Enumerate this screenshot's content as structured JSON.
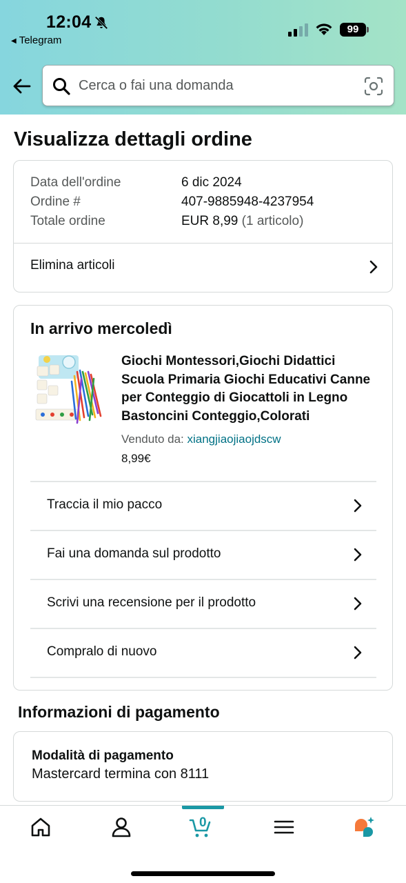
{
  "status_bar": {
    "time": "12:04",
    "back_app": "Telegram",
    "battery": "99"
  },
  "search": {
    "placeholder": "Cerca o fai una domanda"
  },
  "page": {
    "title": "Visualizza dettagli ordine"
  },
  "order_summary": {
    "rows": [
      {
        "label": "Data dell'ordine",
        "value": "6 dic 2024"
      },
      {
        "label": "Ordine #",
        "value": "407-9885948-4237954"
      },
      {
        "label": "Totale ordine",
        "value": "EUR 8,99",
        "extra": "(1 articolo)"
      }
    ],
    "delete_label": "Elimina articoli"
  },
  "delivery": {
    "title": "In arrivo mercoledì",
    "product": {
      "title": "Giochi Montessori,Giochi Didattici Scuola Primaria Giochi Educativi Canne per Conteggio di Giocattoli in Legno Bastoncini Conteggio,Colorati",
      "seller_label": "Venduto da:",
      "seller": "xiangjiaojiaojdscw",
      "price": "8,99€"
    },
    "actions": [
      "Traccia il mio pacco",
      "Fai una domanda sul prodotto",
      "Scrivi una recensione per il prodotto",
      "Compralo di nuovo"
    ]
  },
  "payment": {
    "section_title": "Informazioni di pagamento",
    "method_label": "Modalità di pagamento",
    "method_value": "Mastercard termina con 8111"
  },
  "tabbar": {
    "items": [
      "home-icon",
      "account-icon",
      "cart-icon",
      "menu-icon",
      "rufus-ai-icon"
    ],
    "cart_count": "0"
  },
  "colors": {
    "accent": "#1a98a5",
    "link": "#007185",
    "header_gradient_start": "#86d6de",
    "header_gradient_end": "#a4e3c7"
  }
}
